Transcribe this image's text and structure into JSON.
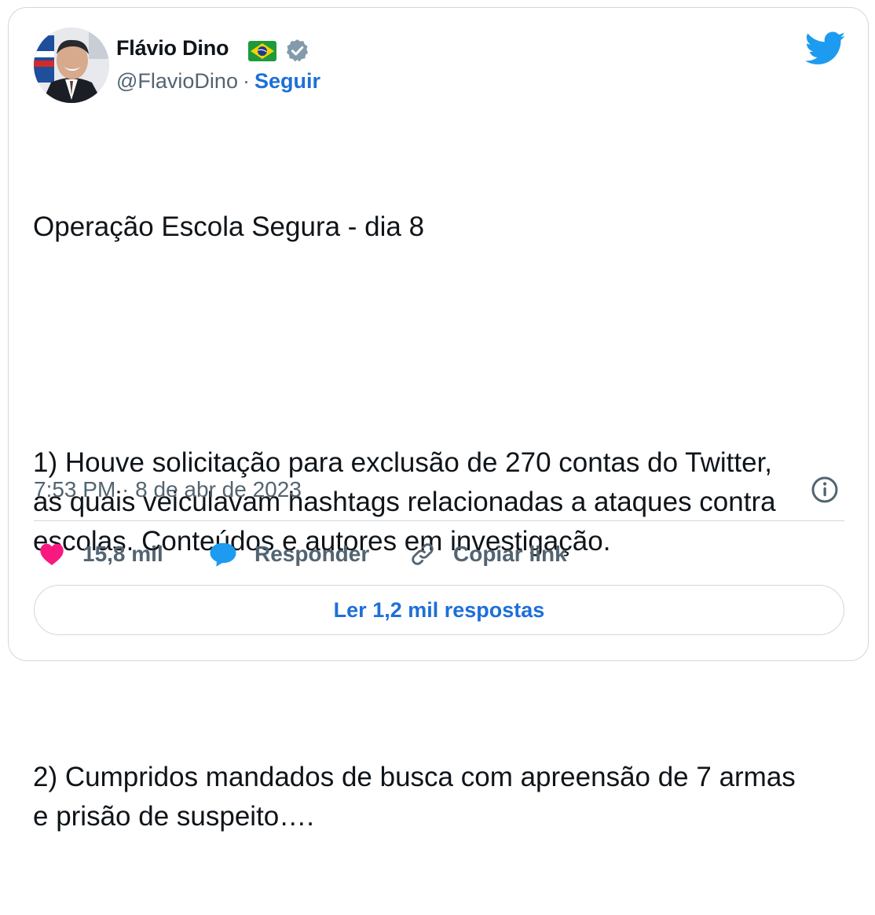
{
  "author": {
    "name": "Flávio Dino",
    "flag_icon": "brazil-flag-icon",
    "verified_icon": "verified-badge-icon",
    "handle": "@FlavioDino",
    "separator": "·",
    "follow_label": "Seguir"
  },
  "brand_icon": "twitter-bird-icon",
  "tweet": {
    "lines": [
      "Operação Escola Segura - dia 8",
      "1) Houve solicitação para exclusão de 270 contas do Twitter, as quais veiculavam hashtags relacionadas a ataques contra escolas. Conteúdos e autores em investigação.",
      "2) Cumpridos mandados de busca com apreensão de 7 armas e prisão de suspeito…."
    ],
    "timestamp": "7:53 PM · 8 de abr de 2023"
  },
  "actions": {
    "like_count": "15,8 mil",
    "reply_label": "Responder",
    "copy_link_label": "Copiar link"
  },
  "read_replies_label": "Ler 1,2 mil respostas",
  "colors": {
    "accent": "#1d6fd8",
    "twitter_blue": "#1d9bf0",
    "like_pink": "#f91880",
    "secondary_text": "#536471",
    "border": "#cfd9de"
  }
}
